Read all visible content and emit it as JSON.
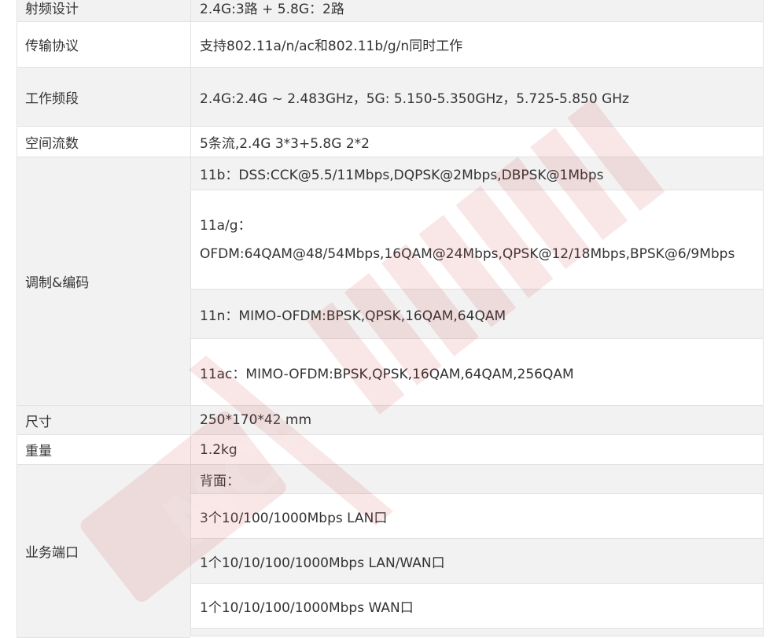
{
  "rows": {
    "rf_design": {
      "label": "射频设计",
      "value": "2.4G:3路 + 5.8G：2路"
    },
    "protocol": {
      "label": "传输协议",
      "value": "支持802.11a/n/ac和802.11b/g/n同时工作"
    },
    "freq": {
      "label": "工作频段",
      "value": "2.4G:2.4G ~ 2.483GHz，5G: 5.150-5.350GHz，5.725-5.850 GHz"
    },
    "streams": {
      "label": "空间流数",
      "value": "5条流,2.4G 3*3+5.8G 2*2"
    },
    "modulation": {
      "label": "调制&编码",
      "b": "11b：DSS:CCK@5.5/11Mbps,DQPSK@2Mbps,DBPSK@1Mbps",
      "ag_line1": "11a/g：",
      "ag_line2": "OFDM:64QAM@48/54Mbps,16QAM@24Mbps,QPSK@12/18Mbps,BPSK@6/9Mbps",
      "n": "11n：MIMO-OFDM:BPSK,QPSK,16QAM,64QAM",
      "ac": "11ac：MIMO-OFDM:BPSK,QPSK,16QAM,64QAM,256QAM"
    },
    "size": {
      "label": "尺寸",
      "value": "250*170*42 mm"
    },
    "weight": {
      "label": "重量",
      "value": "1.2kg"
    },
    "ports": {
      "label": "业务端口",
      "p1": "背面：",
      "p2": "3个10/100/1000Mbps LAN口",
      "p3": "1个10/10/100/1000Mbps LAN/WAN口",
      "p4": "1个10/10/100/1000Mbps WAN口"
    }
  },
  "watermark": {
    "text": "MCE"
  },
  "colors": {
    "row_shade": "#f2f2f2",
    "border": "#e2e2e2",
    "text": "#333333",
    "watermark": "#c0392b"
  }
}
